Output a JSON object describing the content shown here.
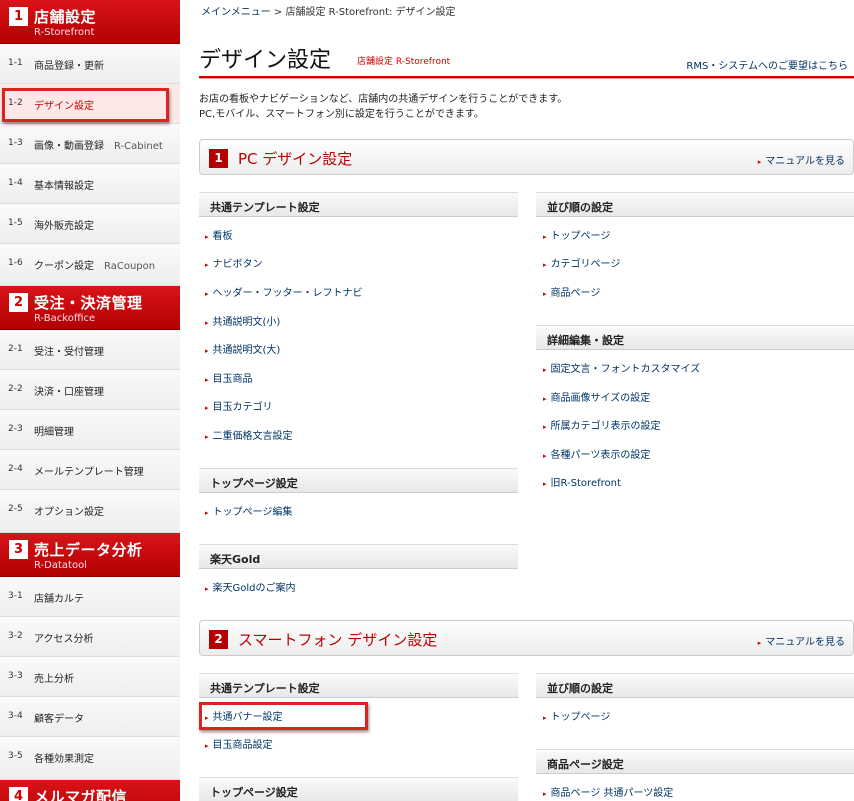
{
  "sidebar": {
    "sections": [
      {
        "num": "1",
        "title": "店舗設定",
        "sub": "R-Storefront"
      },
      {
        "num": "2",
        "title": "受注・決済管理",
        "sub": "R-Backoffice"
      },
      {
        "num": "3",
        "title": "売上データ分析",
        "sub": "R-Datatool"
      },
      {
        "num": "4",
        "title": "メルマガ配信",
        "sub": ""
      }
    ],
    "items": [
      {
        "num": "1-1",
        "label": "商品登録・更新",
        "extra": ""
      },
      {
        "num": "1-2",
        "label": "デザイン設定",
        "extra": ""
      },
      {
        "num": "1-3",
        "label": "画像・動画登録",
        "extra": "R-Cabinet"
      },
      {
        "num": "1-4",
        "label": "基本情報設定",
        "extra": ""
      },
      {
        "num": "1-5",
        "label": "海外販売設定",
        "extra": ""
      },
      {
        "num": "1-6",
        "label": "クーポン設定",
        "extra": "RaCoupon"
      },
      {
        "num": "2-1",
        "label": "受注・受付管理",
        "extra": ""
      },
      {
        "num": "2-2",
        "label": "決済・口座管理",
        "extra": ""
      },
      {
        "num": "2-3",
        "label": "明細管理",
        "extra": ""
      },
      {
        "num": "2-4",
        "label": "メールテンプレート管理",
        "extra": ""
      },
      {
        "num": "2-5",
        "label": "オプション設定",
        "extra": ""
      },
      {
        "num": "3-1",
        "label": "店舗カルテ",
        "extra": ""
      },
      {
        "num": "3-2",
        "label": "アクセス分析",
        "extra": ""
      },
      {
        "num": "3-3",
        "label": "売上分析",
        "extra": ""
      },
      {
        "num": "3-4",
        "label": "顧客データ",
        "extra": ""
      },
      {
        "num": "3-5",
        "label": "各種効果測定",
        "extra": ""
      }
    ]
  },
  "breadcrumb": {
    "home": "メインメニュー",
    "sep": " > ",
    "rest": "店舗設定  R-Storefront: デザイン設定"
  },
  "page": {
    "title": "デザイン設定",
    "subtitle": "店舗設定 R-Storefront",
    "request_link": "RMS・システムへのご要望はこちら",
    "desc_line1": "お店の看板やナビゲーションなど、店舗内の共通デザインを行うことができます。",
    "desc_line2": "PC,モバイル、スマートフォン別に設定を行うことができます。"
  },
  "pc": {
    "num": "1",
    "title": "PC デザイン設定",
    "manual": "マニュアルを見る",
    "common_head": "共通テンプレート設定",
    "common_links": [
      "看板",
      "ナビボタン",
      "ヘッダー・フッター・レフトナビ",
      "共通説明文(小)",
      "共通説明文(大)",
      "目玉商品",
      "目玉カテゴリ",
      "二重価格文言設定"
    ],
    "order_head": "並び順の設定",
    "order_links": [
      "トップページ",
      "カテゴリページ",
      "商品ページ"
    ],
    "detail_head": "詳細編集・設定",
    "detail_links": [
      "固定文言・フォントカスタマイズ",
      "商品画像サイズの設定",
      "所属カテゴリ表示の設定",
      "各種パーツ表示の設定",
      "旧R-Storefront"
    ],
    "top_head": "トップページ設定",
    "top_links": [
      "トップページ編集"
    ],
    "gold_head": "楽天Gold",
    "gold_links": [
      "楽天Goldのご案内"
    ]
  },
  "sp": {
    "num": "2",
    "title": "スマートフォン デザイン設定",
    "manual": "マニュアルを見る",
    "common_head": "共通テンプレート設定",
    "common_links": [
      "共通バナー設定",
      "目玉商品設定"
    ],
    "order_head": "並び順の設定",
    "order_links": [
      "トップページ"
    ],
    "item_head": "商品ページ設定",
    "item_links": [
      "商品ページ 共通パーツ設定"
    ],
    "top_head": "トップページ設定"
  },
  "arrow_glyph": "▸"
}
